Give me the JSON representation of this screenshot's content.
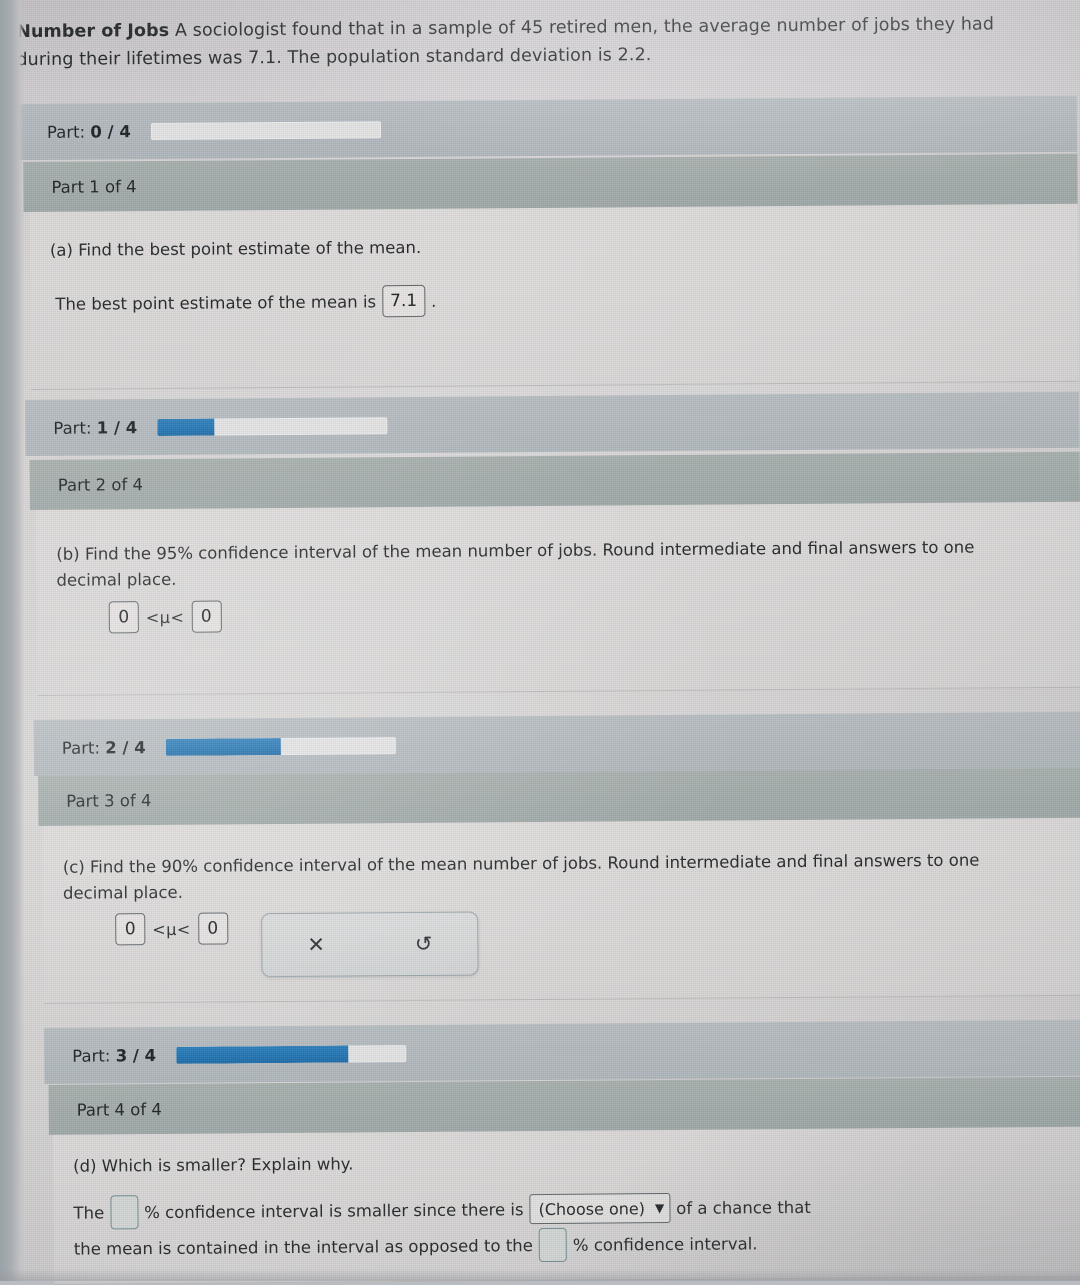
{
  "problem": {
    "title": "Number of Jobs",
    "text": " A sociologist found that in a sample of 45 retired men, the average number of jobs they had during their lifetimes was 7.1. The population standard deviation is 2.2."
  },
  "colors": {
    "progress_fill": "#2276b4",
    "part_header_bg": "#a3adab",
    "score_bar_bg": "#aeb7bc",
    "blank_border": "#6f8d90"
  },
  "sections": [
    {
      "score_label_prefix": "Part:",
      "score_label_value": "0 / 4",
      "progress_percent": 0,
      "header": "Part 1 of 4",
      "question": "(a) Find the best point estimate of the mean.",
      "answer_lead": "The best point estimate of the mean is",
      "answer_value": "7.1",
      "answer_trail": "."
    },
    {
      "score_label_prefix": "Part:",
      "score_label_value": "1 / 4",
      "progress_percent": 25,
      "header": "Part 2 of 4",
      "question": "(b) Find the 95% confidence interval of the mean number of jobs. Round intermediate and final answers to one decimal place.",
      "lower_value": "0",
      "operator_left": "<",
      "mu": "μ",
      "operator_right": "<",
      "upper_value": "0"
    },
    {
      "score_label_prefix": "Part:",
      "score_label_value": "2 / 4",
      "progress_percent": 50,
      "header": "Part 3 of 4",
      "question": "(c) Find the 90% confidence interval of the mean number of jobs. Round intermediate and final answers to one decimal place.",
      "lower_value": "0",
      "operator_left": "<",
      "mu": "μ",
      "operator_right": "<",
      "upper_value": "0",
      "toolbar": {
        "clear_icon": "✕",
        "clear_icon_name": "clear-x-icon",
        "undo_icon": "↺",
        "undo_icon_name": "undo-icon"
      }
    },
    {
      "score_label_prefix": "Part:",
      "score_label_value": "3 / 4",
      "progress_percent": 75,
      "header": "Part 4 of 4",
      "question": "(d) Which is smaller? Explain why.",
      "line1_a": "The",
      "line1_blank": "",
      "line1_b": "% confidence interval is smaller since there is",
      "select_value": "(Choose one)",
      "select_caret": "▼",
      "line1_c": "of a chance that",
      "line2_a": "the mean is contained in the interval as opposed to the",
      "line2_blank": "",
      "line2_b": "% confidence interval."
    }
  ]
}
